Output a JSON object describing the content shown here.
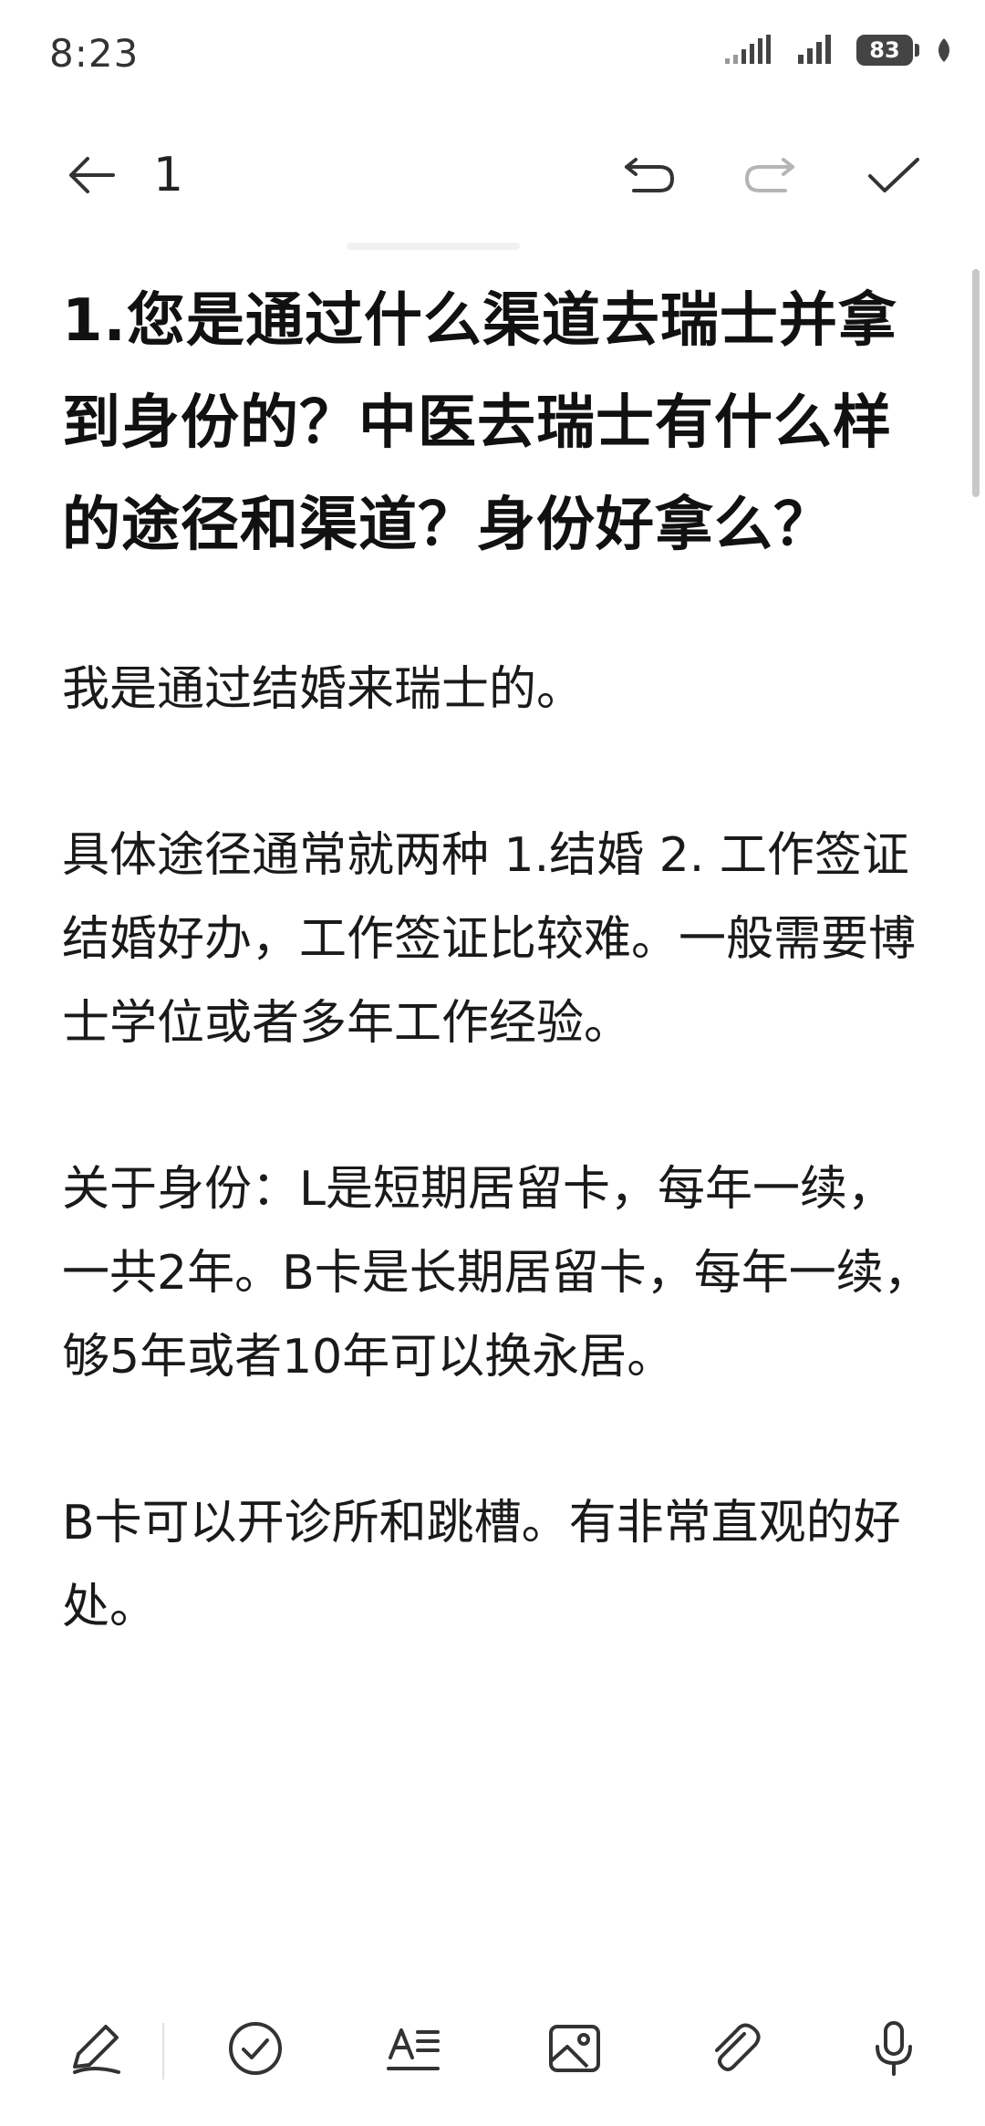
{
  "status_bar": {
    "time": "8:23",
    "battery_level": "83"
  },
  "toolbar": {
    "title": "1"
  },
  "note": {
    "heading": "1.您是通过什么渠道去瑞士并拿到身份的？中医去瑞士有什么样的途径和渠道？身份好拿么？",
    "paragraphs": [
      "我是通过结婚来瑞士的。",
      "具体途径通常就两种 1.结婚 2. 工作签证 结婚好办，工作签证比较难。一般需要博士学位或者多年工作经验。",
      "关于身份：L是短期居留卡，每年一续，一共2年。B卡是长期居留卡，每年一续，够5年或者10年可以换永居。",
      "B卡可以开诊所和跳槽。有非常直观的好处。"
    ]
  },
  "icons": {
    "back": "arrow-left-icon",
    "undo": "undo-icon",
    "redo": "redo-icon",
    "done": "checkmark-icon",
    "pen": "pen-icon",
    "checklist": "check-circle-icon",
    "text_format": "text-format-icon",
    "image": "image-icon",
    "attachment": "paperclip-icon",
    "voice": "microphone-icon"
  },
  "colors": {
    "background": "#ffffff",
    "text": "#111111",
    "icon": "#333333",
    "icon_disabled": "#b5b5b5"
  }
}
